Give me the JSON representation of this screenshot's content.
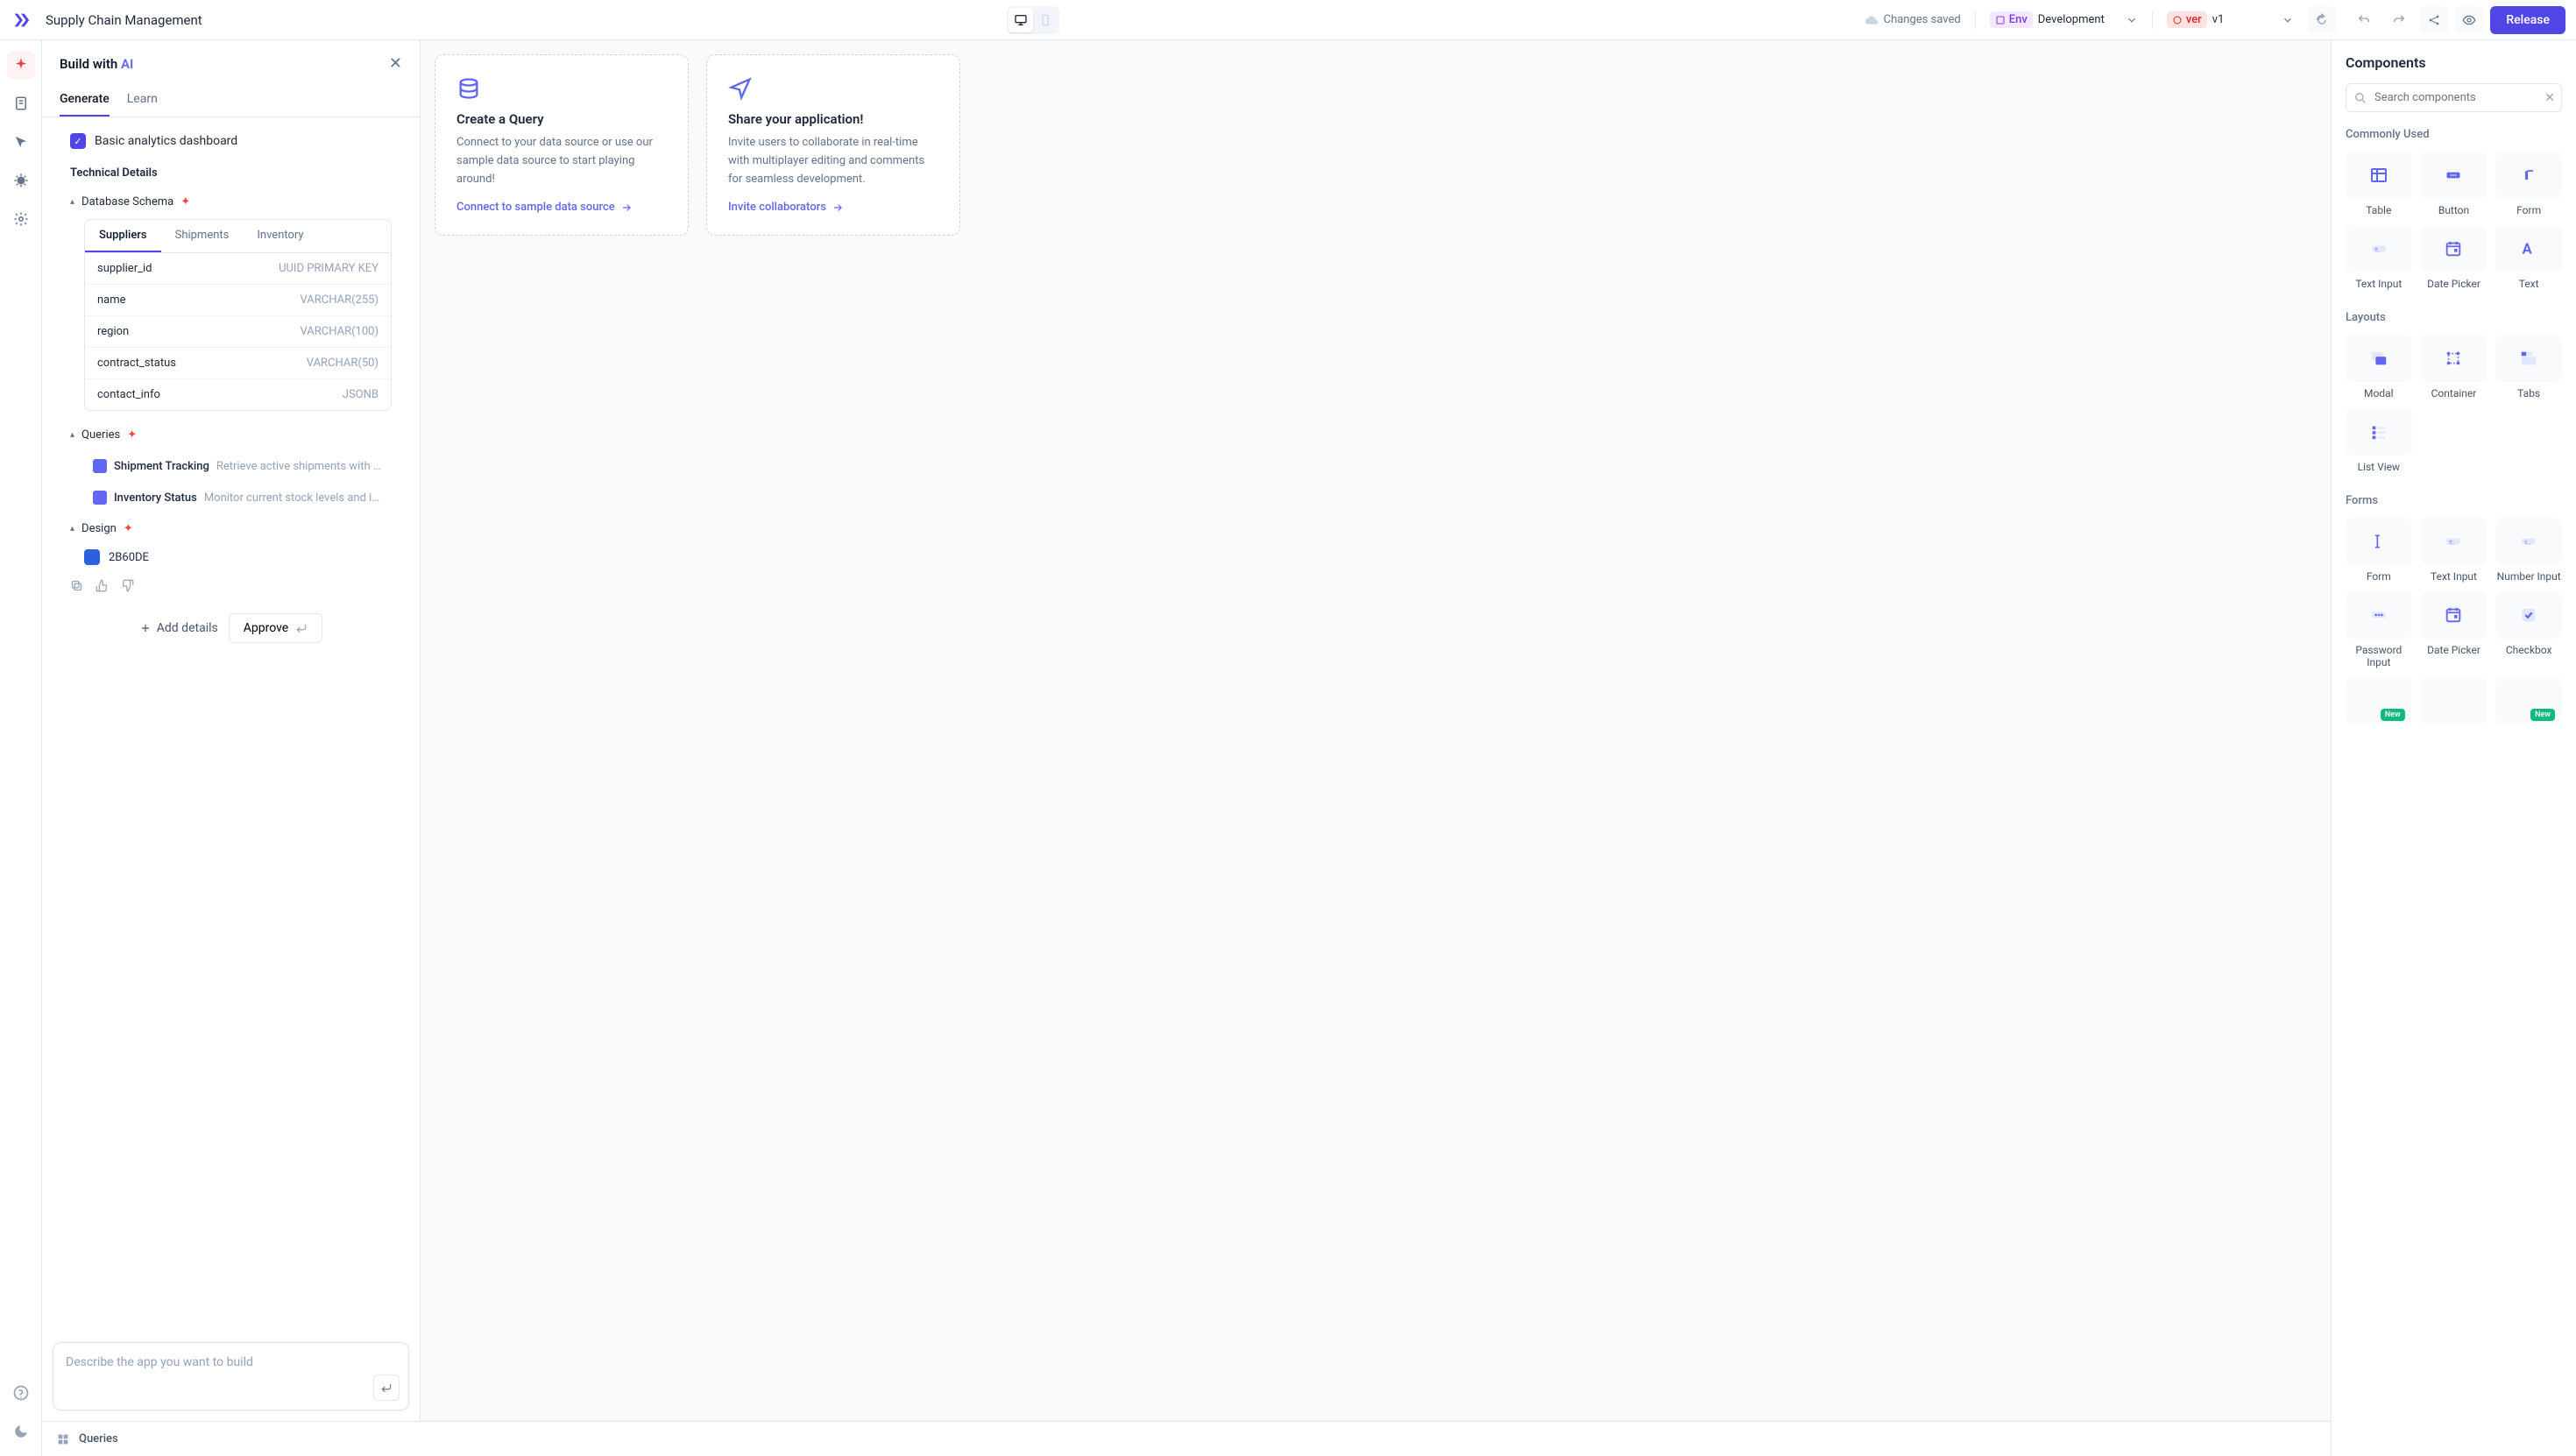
{
  "topbar": {
    "app_title": "Supply Chain Management",
    "status": "Changes saved",
    "env_label": "Env",
    "env_value": "Development",
    "ver_label": "ver",
    "ver_value": "v1",
    "release": "Release"
  },
  "ai_panel": {
    "title_prefix": "Build with ",
    "title_ai": "AI",
    "tabs": [
      "Generate",
      "Learn"
    ],
    "checklist_item": "Basic analytics dashboard",
    "technical_details": "Technical Details",
    "database_schema": "Database Schema",
    "schema_tabs": [
      "Suppliers",
      "Shipments",
      "Inventory"
    ],
    "schema_rows": [
      {
        "name": "supplier_id",
        "type": "UUID PRIMARY KEY"
      },
      {
        "name": "name",
        "type": "VARCHAR(255)"
      },
      {
        "name": "region",
        "type": "VARCHAR(100)"
      },
      {
        "name": "contract_status",
        "type": "VARCHAR(50)"
      },
      {
        "name": "contact_info",
        "type": "JSONB"
      }
    ],
    "queries_label": "Queries",
    "queries": [
      {
        "name": "Shipment Tracking",
        "desc": "Retrieve active shipments with their curre..."
      },
      {
        "name": "Inventory Status",
        "desc": "Monitor current stock levels and identify ite..."
      }
    ],
    "design_label": "Design",
    "color_hex": "2B60DE",
    "add_details": "Add details",
    "approve": "Approve",
    "prompt_placeholder": "Describe the app you want to build"
  },
  "canvas_cards": {
    "query": {
      "title": "Create a Query",
      "body": "Connect to your data source or use our sample data source to start playing around!",
      "link": "Connect to sample data source"
    },
    "share": {
      "title": "Share your application!",
      "body": "Invite users to collaborate in real-time with multiplayer editing and comments for seamless development.",
      "link": "Invite collaborators"
    }
  },
  "queries_bar": "Queries",
  "components_panel": {
    "title": "Components",
    "search_placeholder": "Search components",
    "sections": {
      "commonly_used": {
        "label": "Commonly Used",
        "items": [
          "Table",
          "Button",
          "Form",
          "Text Input",
          "Date Picker",
          "Text"
        ]
      },
      "layouts": {
        "label": "Layouts",
        "items": [
          "Modal",
          "Container",
          "Tabs",
          "List View"
        ]
      },
      "forms": {
        "label": "Forms",
        "items": [
          "Form",
          "Text Input",
          "Number Input",
          "Password Input",
          "Date Picker",
          "Checkbox"
        ],
        "new_row": [
          "New",
          "New"
        ]
      }
    }
  }
}
